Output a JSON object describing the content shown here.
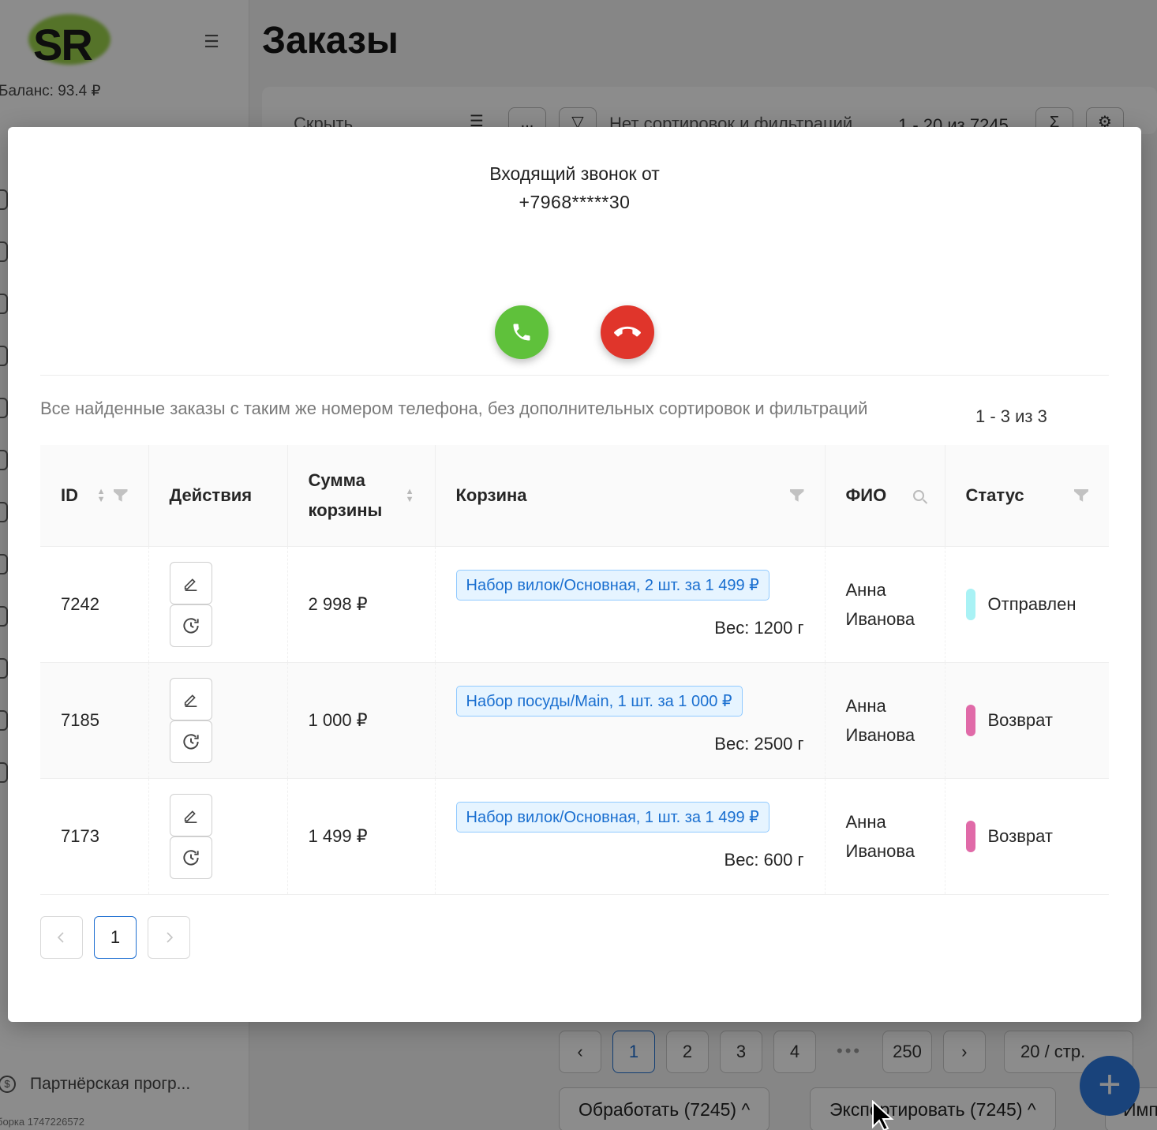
{
  "app": {
    "logo_text": "SR",
    "balance": "Баланс:  93.4 ₽",
    "partner_label": "Партнёрская прогр...",
    "build_label": "борка 1747226572",
    "page_title": "Заказы"
  },
  "toolbar": {
    "hide_label": "Скрыть",
    "more_label": "...",
    "sort_status": "Нет сортировок и фильтраций",
    "count": "1 - 20 из 7245"
  },
  "bg_pagination": {
    "pages": [
      "1",
      "2",
      "3",
      "4",
      "•••",
      "250"
    ],
    "per_page": "20 / стр."
  },
  "bg_actions": {
    "process": "Обработать (7245)",
    "export": "Экспортировать (7245)",
    "import": "Имп"
  },
  "call": {
    "title": "Входящий звонок от",
    "phone": "+7968*****30",
    "accept_color": "#5fc13b",
    "decline_color": "#e0352b"
  },
  "orders": {
    "description": "Все найденные заказы с таким же номером телефона, без дополнительных сортировок и фильтраций",
    "count": "1 - 3 из 3",
    "columns": {
      "id": "ID",
      "actions": "Действия",
      "sum_line1": "Сумма",
      "sum_line2": "корзины",
      "cart": "Корзина",
      "fio": "ФИО",
      "status": "Статус"
    },
    "rows": [
      {
        "id": "7242",
        "sum": "2 998 ₽",
        "cart_item": "Набор вилок/Основная, 2 шт. за 1 499 ₽",
        "weight": "Вес: 1200 г",
        "first_name": "Анна",
        "last_name": "Иванова",
        "status": "Отправлен",
        "status_color": "#a9f2f5"
      },
      {
        "id": "7185",
        "sum": "1 000 ₽",
        "cart_item": "Набор посуды/Main, 1 шт. за 1 000 ₽",
        "weight": "Вес: 2500 г",
        "first_name": "Анна",
        "last_name": "Иванова",
        "status": "Возврат",
        "status_color": "#e06aa8"
      },
      {
        "id": "7173",
        "sum": "1 499 ₽",
        "cart_item": "Набор вилок/Основная, 1 шт. за 1 499 ₽",
        "weight": "Вес: 600 г",
        "first_name": "Анна",
        "last_name": "Иванова",
        "status": "Возврат",
        "status_color": "#e06aa8"
      }
    ],
    "pagination": {
      "current": "1"
    }
  }
}
